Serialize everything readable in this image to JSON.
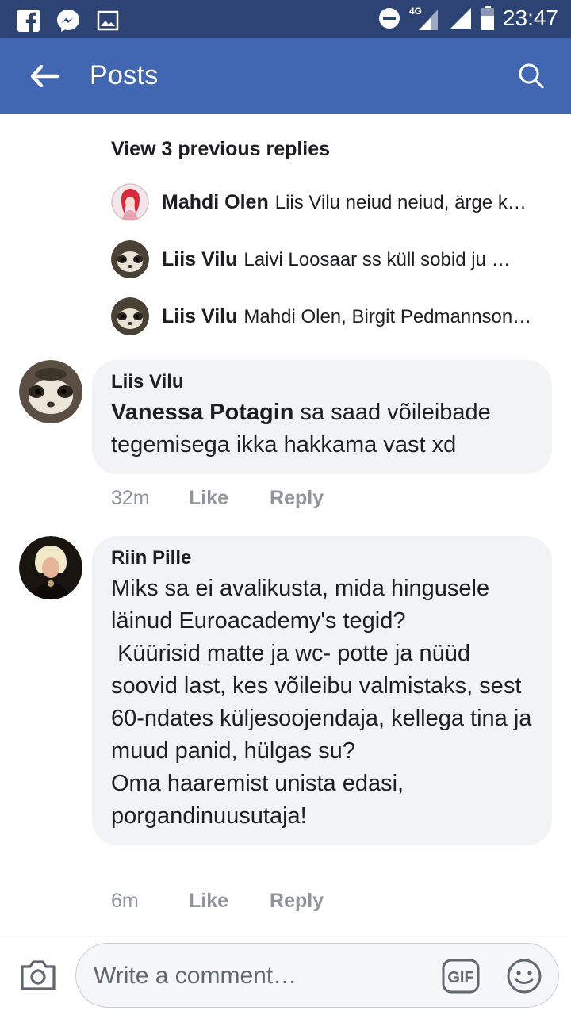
{
  "status_bar": {
    "time": "23:47",
    "network_label": "4G",
    "left_icons": [
      "facebook-icon",
      "messenger-icon",
      "gallery-icon"
    ],
    "right_icons": [
      "do-not-disturb-icon",
      "signal-4g-icon",
      "signal-icon",
      "battery-icon"
    ]
  },
  "app_bar": {
    "title": "Posts",
    "color": "#4267b2"
  },
  "thread": {
    "view_previous": "View 3 previous replies",
    "replies": [
      {
        "name": "Mahdi Olen",
        "preview": "Liis Vilu neiud neiud, ärge k…"
      },
      {
        "name": "Liis Vilu",
        "preview": "Laivi Loosaar ss küll sobid ju …"
      },
      {
        "name": "Liis Vilu",
        "preview": "Mahdi Olen, Birgit Pedmannson…"
      }
    ]
  },
  "comments": [
    {
      "author": "Liis Vilu",
      "mention": "Vanessa Potagin",
      "text": " sa saad võileibade tegemisega ikka hakkama vast xd",
      "time": "32m",
      "like_label": "Like",
      "reply_label": "Reply"
    },
    {
      "author": "Riin Pille",
      "text": "Miks sa ei avalikusta, mida hingusele läinud Euroacademy's tegid?\n Küürisid matte ja wc- potte ja nüüd soovid last, kes võileibu valmistaks, sest 60-ndates küljesoojendaja, kellega tina ja muud panid, hülgas su?\nOma haaremist unista edasi, porgandinuusutaja!",
      "time": "6m",
      "like_label": "Like",
      "reply_label": "Reply"
    }
  ],
  "composer": {
    "placeholder": "Write a comment…",
    "gif_label": "GIF"
  },
  "colors": {
    "status_bar": "#2d4373",
    "bubble": "#f2f3f5",
    "meta_text": "#90949c"
  }
}
